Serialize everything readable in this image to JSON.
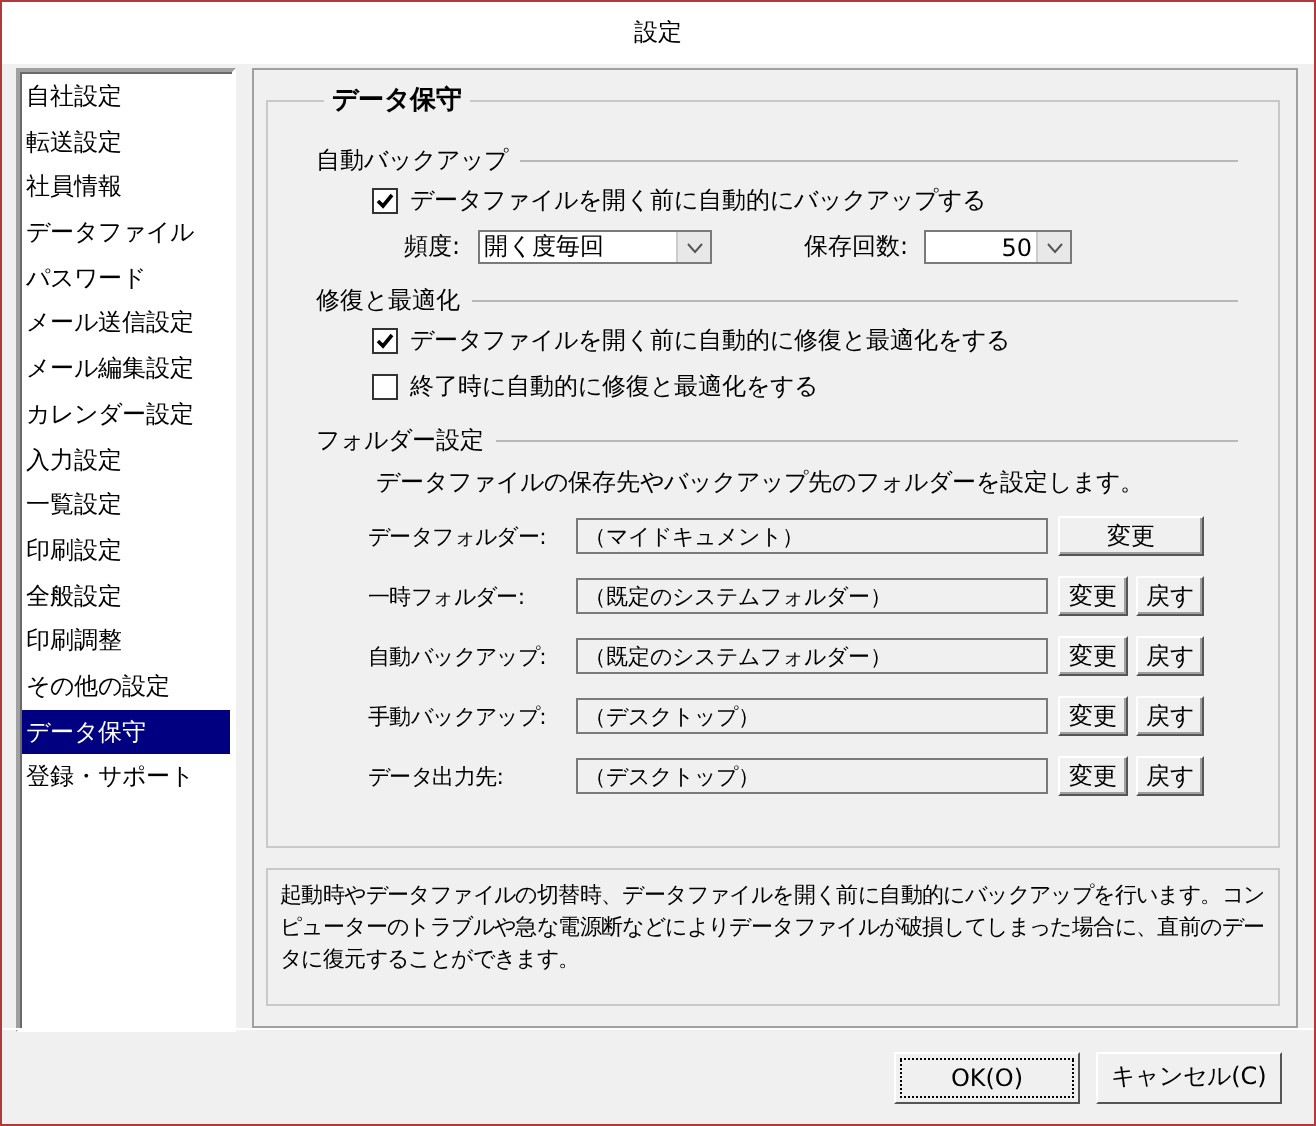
{
  "window": {
    "title": "設定"
  },
  "sidebar": {
    "items": [
      {
        "label": "自社設定",
        "selected": false
      },
      {
        "label": "転送設定",
        "selected": false
      },
      {
        "label": "社員情報",
        "selected": false
      },
      {
        "label": "データファイル",
        "selected": false
      },
      {
        "label": "パスワード",
        "selected": false
      },
      {
        "label": "メール送信設定",
        "selected": false
      },
      {
        "label": "メール編集設定",
        "selected": false
      },
      {
        "label": "カレンダー設定",
        "selected": false
      },
      {
        "label": "入力設定",
        "selected": false
      },
      {
        "label": "一覧設定",
        "selected": false
      },
      {
        "label": "印刷設定",
        "selected": false
      },
      {
        "label": "全般設定",
        "selected": false
      },
      {
        "label": "印刷調整",
        "selected": false
      },
      {
        "label": "その他の設定",
        "selected": false
      },
      {
        "label": "データ保守",
        "selected": true
      },
      {
        "label": "登録・サポート",
        "selected": false
      }
    ]
  },
  "group": {
    "title": "データ保守",
    "auto_backup": {
      "title": "自動バックアップ",
      "checkbox": {
        "label": "データファイルを開く前に自動的にバックアップする",
        "checked": true
      },
      "frequency": {
        "label": "頻度:",
        "value": "開く度毎回"
      },
      "keep_count": {
        "label": "保存回数:",
        "value": "50"
      }
    },
    "repair": {
      "title": "修復と最適化",
      "checkboxes": [
        {
          "label": "データファイルを開く前に自動的に修復と最適化をする",
          "checked": true
        },
        {
          "label": "終了時に自動的に修復と最適化をする",
          "checked": false
        }
      ]
    },
    "folders": {
      "title": "フォルダー設定",
      "description": "データファイルの保存先やバックアップ先のフォルダーを設定します。",
      "rows": [
        {
          "label": "データフォルダー:",
          "value": "（マイドキュメント）",
          "buttons": [
            "変更"
          ]
        },
        {
          "label": "一時フォルダー:",
          "value": "（既定のシステムフォルダー）",
          "buttons": [
            "変更",
            "戻す"
          ]
        },
        {
          "label": "自動バックアップ:",
          "value": "（既定のシステムフォルダー）",
          "buttons": [
            "変更",
            "戻す"
          ]
        },
        {
          "label": "手動バックアップ:",
          "value": "（デスクトップ）",
          "buttons": [
            "変更",
            "戻す"
          ]
        },
        {
          "label": "データ出力先:",
          "value": "（デスクトップ）",
          "buttons": [
            "変更",
            "戻す"
          ]
        }
      ]
    }
  },
  "help_text": "起動時やデータファイルの切替時、データファイルを開く前に自動的にバックアップを行います。コンピューターのトラブルや急な電源断などによりデータファイルが破損してしまった場合に、直前のデータに復元することができます。",
  "buttons": [
    "OK(O)",
    "キャンセル(C)"
  ]
}
